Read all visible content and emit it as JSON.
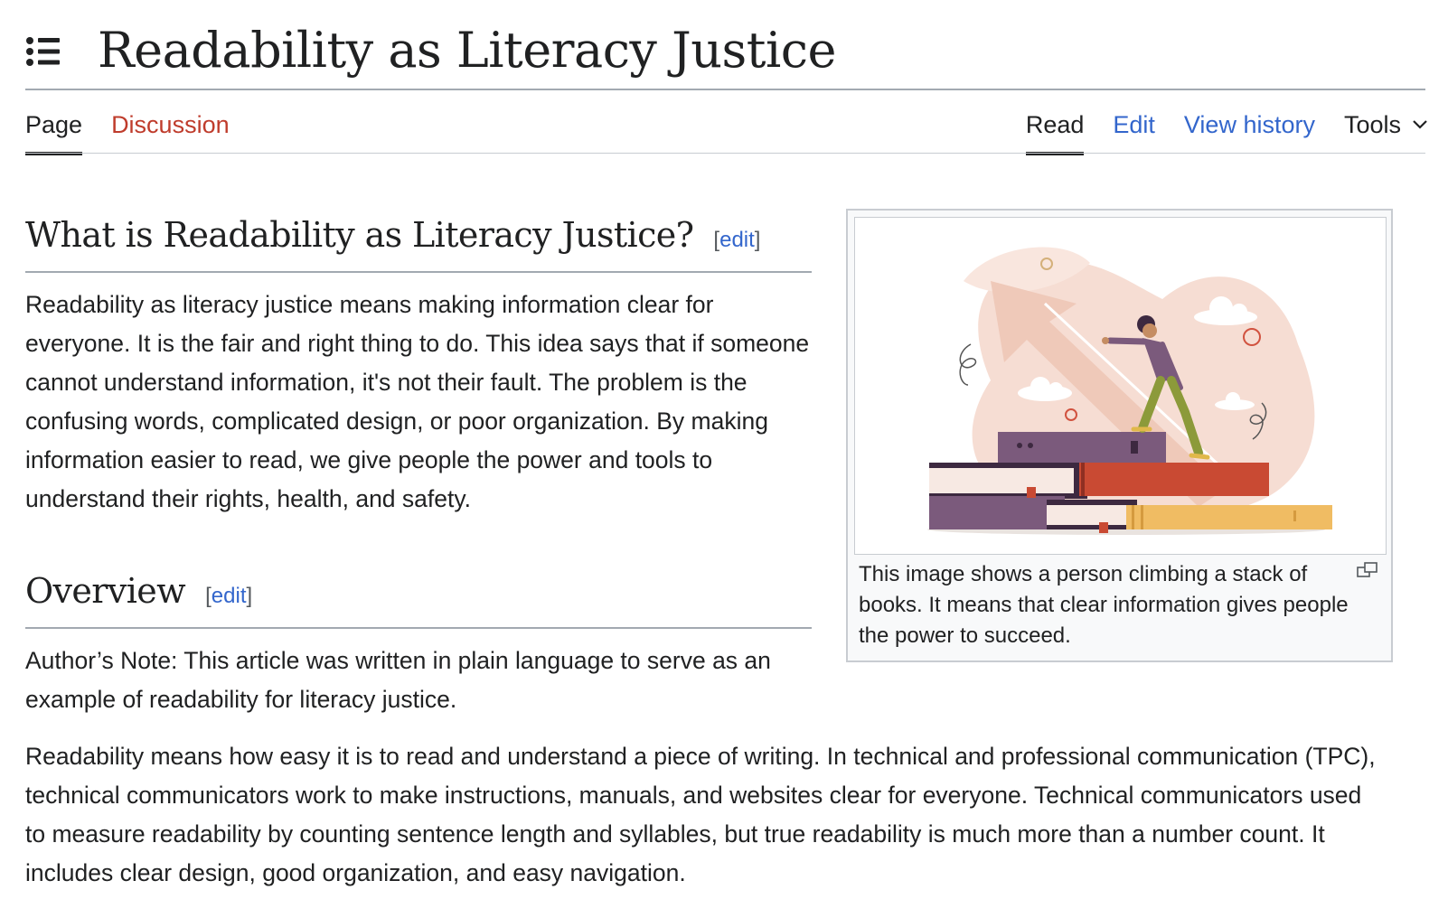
{
  "page": {
    "title": "Readability as Literacy Justice"
  },
  "tabs": {
    "left": [
      {
        "label": "Page",
        "active": true
      },
      {
        "label": "Discussion",
        "active": false
      }
    ],
    "right": [
      {
        "label": "Read",
        "active": true
      },
      {
        "label": "Edit",
        "active": false
      },
      {
        "label": "View history",
        "active": false
      },
      {
        "label": "Tools",
        "active": false
      }
    ]
  },
  "sections": [
    {
      "heading": "What is Readability as Literacy Justice?",
      "edit_label": "edit",
      "paragraphs": [
        "Readability as literacy justice means making information clear for everyone. It is the fair and right thing to do. This idea says that if someone cannot understand information, it's not their fault. The problem is the confusing words, complicated design, or poor organization. By making information easier to read, we give people the power and tools to understand their rights, health, and safety."
      ]
    },
    {
      "heading": "Overview",
      "edit_label": "edit",
      "paragraphs": [
        "Author’s Note: This article was written in plain language to serve as an example of readability for literacy justice.",
        "Readability means how easy it is to read and understand a piece of writing. In technical and professional communication (TPC), technical communicators work to make instructions, manuals, and websites clear for everyone. Technical communicators used to measure readability by counting sentence length and syllables, but true readability is much more than a number count. It includes clear design, good organization, and easy navigation."
      ]
    }
  ],
  "figure": {
    "caption": "This image shows a person climbing a stack of books. It means that clear information gives people the power to succeed."
  },
  "colors": {
    "link": "#3366cc",
    "discussion_red": "#bf3c2c",
    "text": "#202122",
    "rule": "#a2a9b1"
  },
  "icons": {
    "toc": "list-bullet-icon",
    "tools": "chevron-down-icon",
    "enlarge": "enlarge-icon"
  }
}
